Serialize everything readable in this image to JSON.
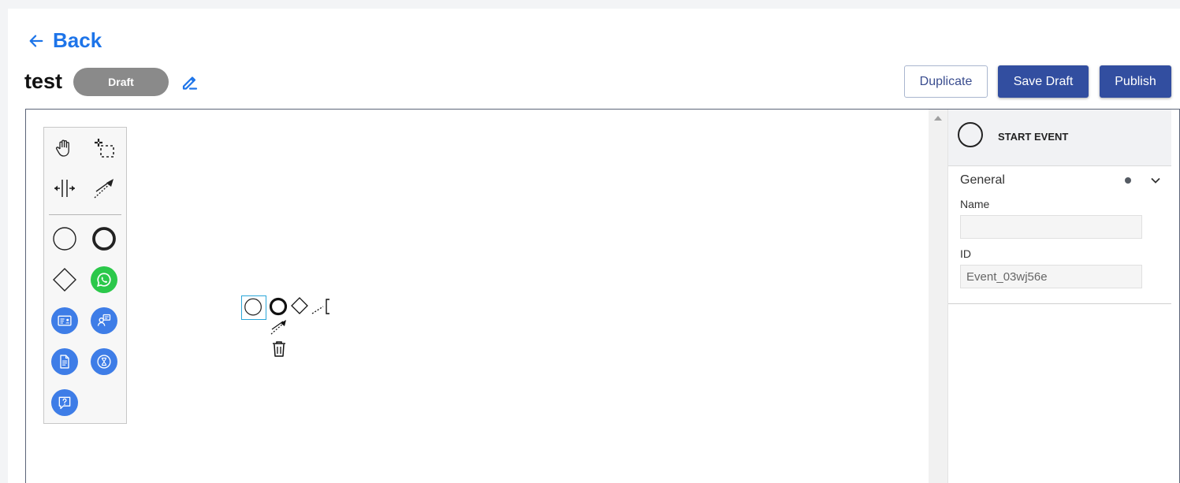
{
  "header": {
    "back_label": "Back",
    "title": "test",
    "status_badge": "Draft",
    "buttons": {
      "duplicate": "Duplicate",
      "save_draft": "Save Draft",
      "publish": "Publish"
    }
  },
  "palette": {
    "tools": [
      {
        "name": "hand-tool",
        "icon": "hand-icon"
      },
      {
        "name": "lasso-tool",
        "icon": "lasso-icon"
      },
      {
        "name": "space-tool",
        "icon": "space-icon"
      },
      {
        "name": "global-connect-tool",
        "icon": "connect-icon"
      },
      {
        "name": "start-event",
        "icon": "start-event-icon"
      },
      {
        "name": "end-event",
        "icon": "end-event-icon"
      },
      {
        "name": "gateway",
        "icon": "gateway-icon"
      },
      {
        "name": "whatsapp-task",
        "icon": "whatsapp-icon"
      },
      {
        "name": "contact-card-task",
        "icon": "id-card-icon"
      },
      {
        "name": "agent-task",
        "icon": "agent-icon"
      },
      {
        "name": "document-task",
        "icon": "document-icon"
      },
      {
        "name": "timer-task",
        "icon": "hourglass-icon"
      },
      {
        "name": "question-task",
        "icon": "question-icon"
      }
    ]
  },
  "properties_panel": {
    "element_type": "START EVENT",
    "group_label": "General",
    "name_label": "Name",
    "name_value": "",
    "id_label": "ID",
    "id_value": "Event_03wj56e"
  },
  "colors": {
    "accent": "#1d74e9",
    "primary_button": "#324ea0",
    "badge": "#8a8a8a",
    "palette_blue": "#3e7de7",
    "whatsapp_green": "#2bc84a",
    "selection": "#2aa6d8"
  }
}
